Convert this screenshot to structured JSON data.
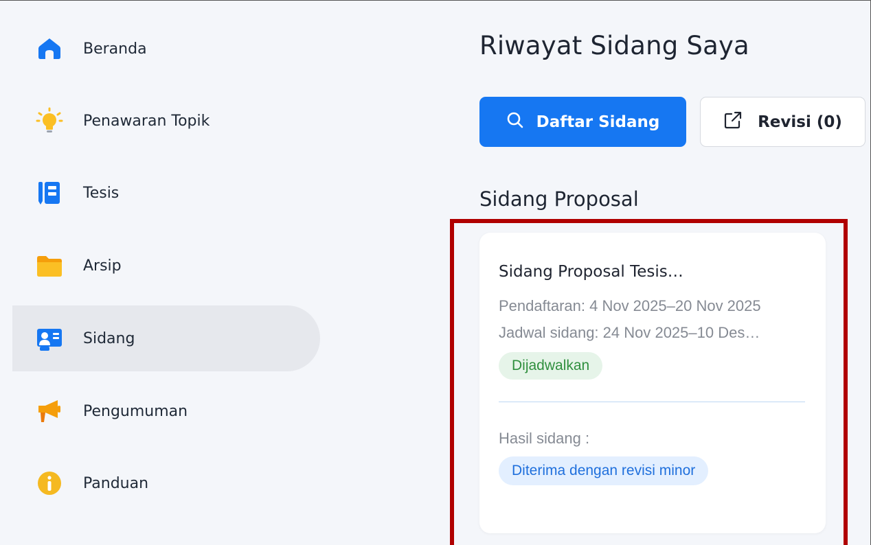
{
  "sidebar": {
    "items": [
      {
        "label": "Beranda",
        "icon": "home-icon",
        "color": "#1677f2"
      },
      {
        "label": "Penawaran Topik",
        "icon": "lightbulb-icon",
        "color": "#fbbf24"
      },
      {
        "label": "Tesis",
        "icon": "notebook-icon",
        "color": "#1677f2"
      },
      {
        "label": "Arsip",
        "icon": "folder-icon",
        "color": "#f5b921"
      },
      {
        "label": "Sidang",
        "icon": "id-card-icon",
        "color": "#1677f2",
        "active": true
      },
      {
        "label": "Pengumuman",
        "icon": "megaphone-icon",
        "color": "#f59e0b"
      },
      {
        "label": "Panduan",
        "icon": "info-icon",
        "color": "#f5b921"
      }
    ]
  },
  "main": {
    "title": "Riwayat Sidang Saya",
    "primary_button": {
      "label": "Daftar Sidang",
      "icon": "search-icon"
    },
    "secondary_button": {
      "label": "Revisi (0)",
      "icon": "external-link-icon"
    },
    "section_title": "Sidang Proposal",
    "card": {
      "title": "Sidang Proposal Tesis…",
      "registration": "Pendaftaran: 4 Nov 2025–20 Nov 2025",
      "schedule": "Jadwal sidang: 24 Nov 2025–10 Des…",
      "status": "Dijadwalkan",
      "result_label": "Hasil sidang :",
      "result": "Diterima dengan revisi minor"
    }
  },
  "colors": {
    "accent": "#1677f2",
    "highlight": "#b00000",
    "status_green": "#2f8f3e",
    "status_blue": "#1f6fdc"
  }
}
